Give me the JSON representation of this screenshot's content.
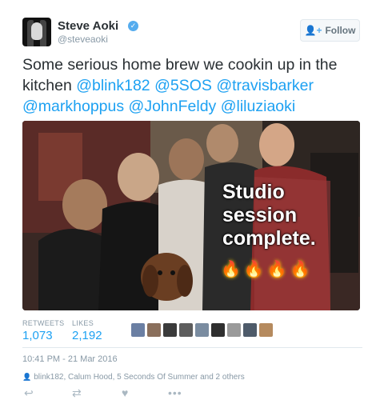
{
  "tweet": {
    "author_name": "Steve Aoki",
    "author_handle": "@steveaoki",
    "follow_label": "Follow",
    "text_plain": "Some serious home brew we cookin up in the kitchen ",
    "mentions": [
      "@blink182",
      "@5SOS",
      "@travisbarker",
      "@markhoppus",
      "@JohnFeldy",
      "@liluziaoki"
    ],
    "photo_caption": [
      "Studio",
      "session",
      "complete."
    ],
    "flames": "🔥🔥🔥🔥",
    "timestamp": "10:41 PM - 21 Mar 2016"
  },
  "stats": {
    "retweets_label": "RETWEETS",
    "retweets": "1,073",
    "likes_label": "LIKES",
    "likes": "2,192"
  },
  "likers_colors": [
    "#6b7fa3",
    "#8a6f5c",
    "#3b3b3b",
    "#5d5d5d",
    "#7a8ca0",
    "#2f2f2f",
    "#9a9a9a",
    "#4e5b6a",
    "#b58a5e"
  ],
  "people_in_photo": "blink182, Calum Hood, 5 Seconds Of Summer and 2 others",
  "icons": {
    "verified": "verified-badge-icon",
    "follow": "add-person-icon",
    "reply": "reply-icon",
    "retweet": "retweet-icon",
    "like": "heart-icon",
    "more": "more-icon",
    "tag": "person-tag-icon"
  },
  "colors": {
    "link": "#1da1f2",
    "text": "#292f33",
    "muted": "#8899a6",
    "divider": "#e1e8ed"
  }
}
